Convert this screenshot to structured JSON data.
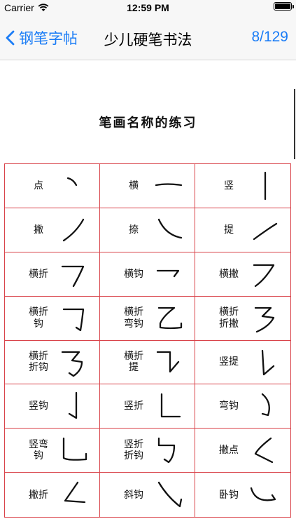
{
  "status_bar": {
    "carrier": "Carrier",
    "time": "12:59 PM"
  },
  "nav": {
    "back_label": "钢笔字帖",
    "title": "少儿硬笔书法",
    "page_count": "8/129"
  },
  "sheet": {
    "title": "笔画名称的练习",
    "strokes": [
      {
        "name": "点",
        "icon": "dian-stroke"
      },
      {
        "name": "横",
        "icon": "heng-stroke"
      },
      {
        "name": "竖",
        "icon": "shu-stroke"
      },
      {
        "name": "撇",
        "icon": "pie-stroke"
      },
      {
        "name": "捺",
        "icon": "na-stroke"
      },
      {
        "name": "提",
        "icon": "ti-stroke"
      },
      {
        "name": "横折",
        "icon": "hengzhe-stroke"
      },
      {
        "name": "横钩",
        "icon": "henggou-stroke"
      },
      {
        "name": "横撇",
        "icon": "hengpie-stroke"
      },
      {
        "name": "横折\n钩",
        "icon": "hengzhegou-stroke"
      },
      {
        "name": "横折\n弯钩",
        "icon": "hengzhewangou-stroke"
      },
      {
        "name": "横折\n折撇",
        "icon": "hengzhezhepie-stroke"
      },
      {
        "name": "横折\n折钩",
        "icon": "hengzhezhegou-stroke"
      },
      {
        "name": "横折\n提",
        "icon": "hengzheti-stroke"
      },
      {
        "name": "竖提",
        "icon": "shuti-stroke"
      },
      {
        "name": "竖钩",
        "icon": "shugou-stroke"
      },
      {
        "name": "竖折",
        "icon": "shuzhe-stroke"
      },
      {
        "name": "弯钩",
        "icon": "wangou-stroke"
      },
      {
        "name": "竖弯\n钩",
        "icon": "shuwangou-stroke"
      },
      {
        "name": "竖折\n折钩",
        "icon": "shuzhezhegou-stroke"
      },
      {
        "name": "撇点",
        "icon": "piedian-stroke"
      },
      {
        "name": "撇折",
        "icon": "piezhe-stroke"
      },
      {
        "name": "斜钩",
        "icon": "xiegou-stroke"
      },
      {
        "name": "卧钩",
        "icon": "wogou-stroke"
      }
    ]
  }
}
